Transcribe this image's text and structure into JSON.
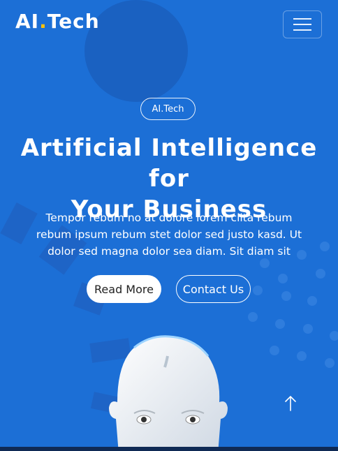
{
  "brand": {
    "name_part1": "AI",
    "dot": ".",
    "name_part2": "Tech"
  },
  "nav": {
    "menu_icon": "hamburger-menu-icon"
  },
  "hero": {
    "badge": "AI.Tech",
    "title_line1": "Artificial Intelligence for",
    "title_line2": "Your Business",
    "description": "Tempor rebum no at dolore lorem clita rebum rebum ipsum rebum stet dolor sed justo kasd. Ut dolor sed magna dolor sea diam. Sit diam sit",
    "read_more": "Read More",
    "contact_us": "Contact Us",
    "image_icon": "robot-head-icon"
  },
  "back_to_top_icon": "arrow-up-icon",
  "colors": {
    "background": "#1c6fd6",
    "accent": "#ffc107",
    "text": "#ffffff"
  }
}
